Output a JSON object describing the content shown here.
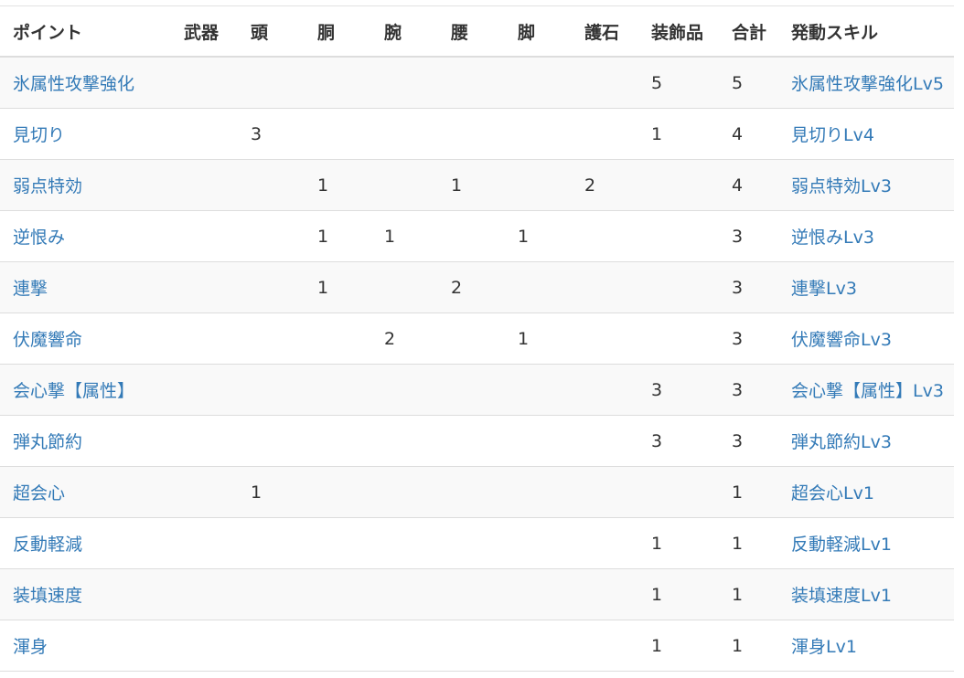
{
  "table": {
    "headers": [
      "ポイント",
      "武器",
      "頭",
      "胴",
      "腕",
      "腰",
      "脚",
      "護石",
      "装飾品",
      "合計",
      "発動スキル"
    ],
    "rows": [
      {
        "point": "氷属性攻撃強化",
        "weapon": "",
        "head": "",
        "body": "",
        "arm": "",
        "waist": "",
        "leg": "",
        "charm": "",
        "deco": "5",
        "total": "5",
        "skill": "氷属性攻撃強化Lv5"
      },
      {
        "point": "見切り",
        "weapon": "",
        "head": "3",
        "body": "",
        "arm": "",
        "waist": "",
        "leg": "",
        "charm": "",
        "deco": "1",
        "total": "4",
        "skill": "見切りLv4"
      },
      {
        "point": "弱点特効",
        "weapon": "",
        "head": "",
        "body": "1",
        "arm": "",
        "waist": "1",
        "leg": "",
        "charm": "2",
        "deco": "",
        "total": "4",
        "skill": "弱点特効Lv3"
      },
      {
        "point": "逆恨み",
        "weapon": "",
        "head": "",
        "body": "1",
        "arm": "1",
        "waist": "",
        "leg": "1",
        "charm": "",
        "deco": "",
        "total": "3",
        "skill": "逆恨みLv3"
      },
      {
        "point": "連撃",
        "weapon": "",
        "head": "",
        "body": "1",
        "arm": "",
        "waist": "2",
        "leg": "",
        "charm": "",
        "deco": "",
        "total": "3",
        "skill": "連撃Lv3"
      },
      {
        "point": "伏魔響命",
        "weapon": "",
        "head": "",
        "body": "",
        "arm": "2",
        "waist": "",
        "leg": "1",
        "charm": "",
        "deco": "",
        "total": "3",
        "skill": "伏魔響命Lv3"
      },
      {
        "point": "会心撃【属性】",
        "weapon": "",
        "head": "",
        "body": "",
        "arm": "",
        "waist": "",
        "leg": "",
        "charm": "",
        "deco": "3",
        "total": "3",
        "skill": "会心撃【属性】Lv3"
      },
      {
        "point": "弾丸節約",
        "weapon": "",
        "head": "",
        "body": "",
        "arm": "",
        "waist": "",
        "leg": "",
        "charm": "",
        "deco": "3",
        "total": "3",
        "skill": "弾丸節約Lv3"
      },
      {
        "point": "超会心",
        "weapon": "",
        "head": "1",
        "body": "",
        "arm": "",
        "waist": "",
        "leg": "",
        "charm": "",
        "deco": "",
        "total": "1",
        "skill": "超会心Lv1"
      },
      {
        "point": "反動軽減",
        "weapon": "",
        "head": "",
        "body": "",
        "arm": "",
        "waist": "",
        "leg": "",
        "charm": "",
        "deco": "1",
        "total": "1",
        "skill": "反動軽減Lv1"
      },
      {
        "point": "装填速度",
        "weapon": "",
        "head": "",
        "body": "",
        "arm": "",
        "waist": "",
        "leg": "",
        "charm": "",
        "deco": "1",
        "total": "1",
        "skill": "装填速度Lv1"
      },
      {
        "point": "渾身",
        "weapon": "",
        "head": "",
        "body": "",
        "arm": "",
        "waist": "",
        "leg": "",
        "charm": "",
        "deco": "1",
        "total": "1",
        "skill": "渾身Lv1"
      }
    ]
  },
  "colors": {
    "link": "#337ab7",
    "text": "#333333",
    "stripe": "#f9f9f9",
    "border": "#dddddd"
  }
}
